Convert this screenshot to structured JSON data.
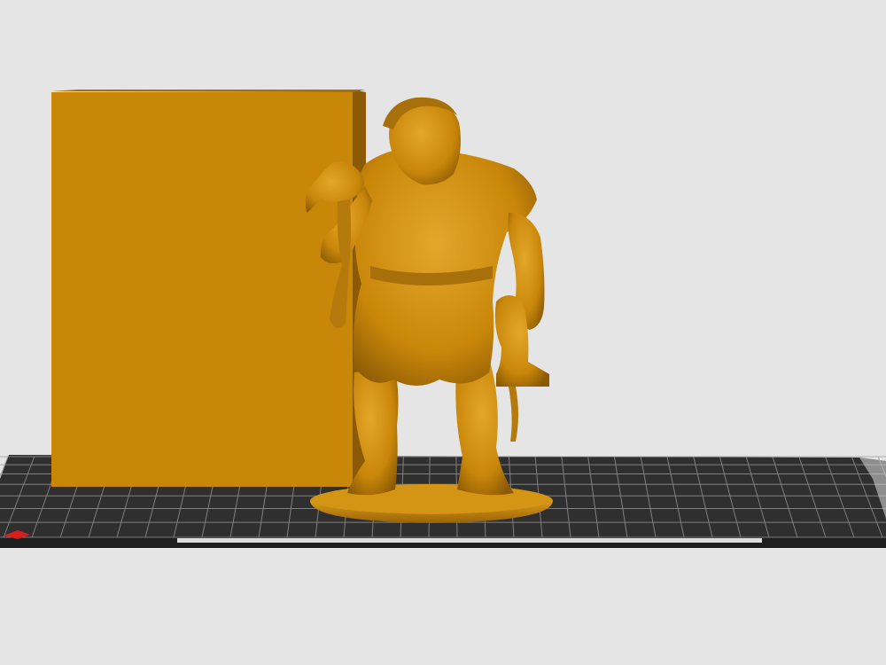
{
  "viewport": {
    "background_color": "#e5e5e5"
  },
  "build_plate": {
    "surface_color": "#2f2f2f",
    "grid_line_color": "#9a9a9a",
    "axis_marker_color": "#d62020",
    "edge_highlight_color": "#f2f2f2"
  },
  "models": {
    "model_color": "#c9870a",
    "shadow_color": "#8c5a05",
    "highlight_color": "#e3a72a",
    "objects": [
      {
        "kind": "wipe-tower-block"
      },
      {
        "kind": "ogre-figurine"
      }
    ]
  }
}
